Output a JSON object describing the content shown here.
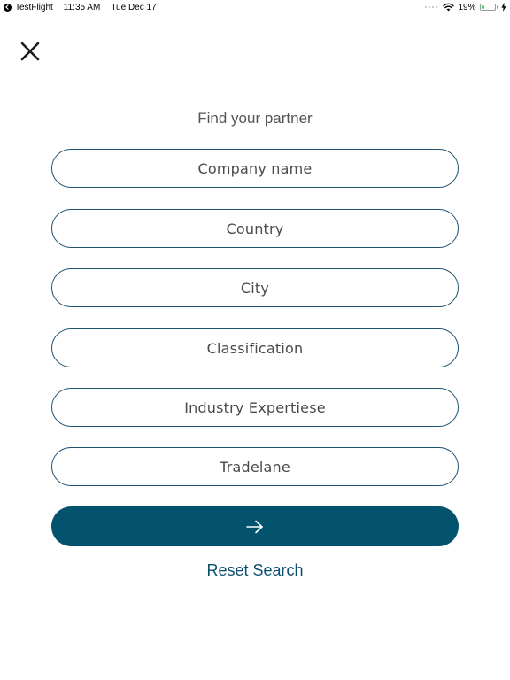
{
  "status_bar": {
    "back_app": "TestFlight",
    "time": "11:35 AM",
    "date": "Tue Dec 17",
    "battery_percent": "19%",
    "battery_level": 0.19,
    "icons": [
      "signal-dots-icon",
      "wifi-icon",
      "battery-icon",
      "charging-bolt-icon"
    ]
  },
  "header": {
    "close_icon": "close-icon"
  },
  "form": {
    "title": "Find your partner",
    "fields": [
      {
        "placeholder": "Company name"
      },
      {
        "placeholder": "Country"
      },
      {
        "placeholder": "City"
      },
      {
        "placeholder": "Classification"
      },
      {
        "placeholder": "Industry Expertiese"
      },
      {
        "placeholder": "Tradelane"
      }
    ],
    "submit_icon": "arrow-right-icon",
    "reset_label": "Reset Search"
  },
  "colors": {
    "primary": "#03536f",
    "field_border": "#1f5270",
    "link": "#0b4f6f",
    "battery_green": "#4cd964"
  }
}
